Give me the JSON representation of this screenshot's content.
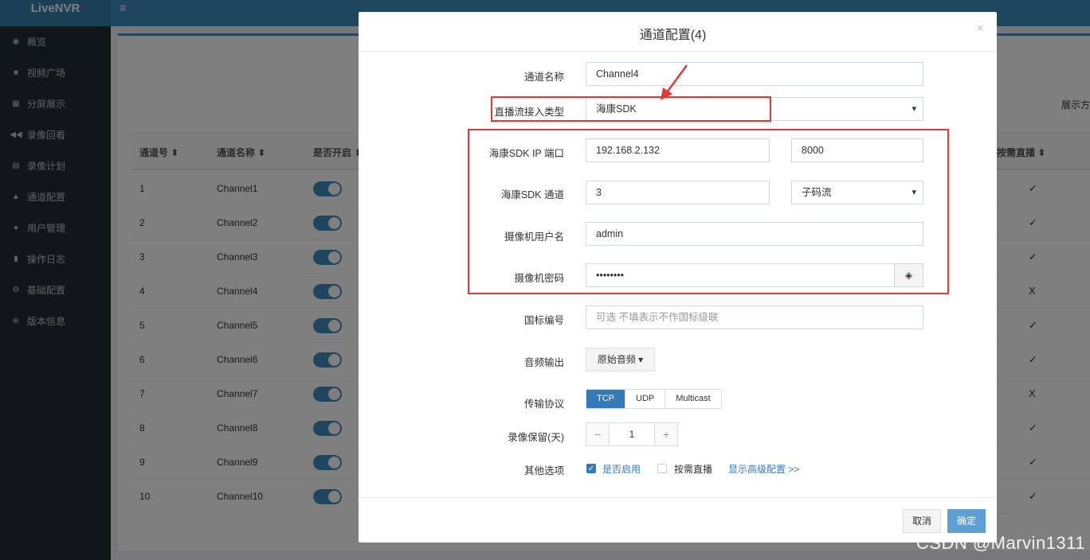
{
  "app": {
    "logo": "LiveNVR",
    "menu_glyph": "≡"
  },
  "sidebar": {
    "items": [
      {
        "label": "概览",
        "icon": "dashboard-icon"
      },
      {
        "label": "视频广场",
        "icon": "video-camera-icon"
      },
      {
        "label": "分屏展示",
        "icon": "grid-icon"
      },
      {
        "label": "录像回看",
        "icon": "rewind-icon"
      },
      {
        "label": "录像计划",
        "icon": "calendar-icon"
      },
      {
        "label": "通道配置",
        "icon": "sitemap-icon"
      },
      {
        "label": "用户管理",
        "icon": "users-icon"
      },
      {
        "label": "操作日志",
        "icon": "file-icon"
      },
      {
        "label": "基础配置",
        "icon": "gears-icon"
      },
      {
        "label": "版本信息",
        "icon": "info-icon"
      }
    ]
  },
  "background_page": {
    "display_label": "展示方",
    "columns": [
      "通道号 ⬍",
      "通道名称 ⬍",
      "是否开启 ⬍",
      "按需直播 ⬍"
    ],
    "rows": [
      {
        "id": "1",
        "name": "Channel1",
        "on_demand": "✓"
      },
      {
        "id": "2",
        "name": "Channel2",
        "on_demand": "✓"
      },
      {
        "id": "3",
        "name": "Channel3",
        "on_demand": "✓"
      },
      {
        "id": "4",
        "name": "Channel4",
        "on_demand": "X"
      },
      {
        "id": "5",
        "name": "Channel5",
        "on_demand": "✓"
      },
      {
        "id": "6",
        "name": "Channel6",
        "on_demand": "✓"
      },
      {
        "id": "7",
        "name": "Channel7",
        "on_demand": "X"
      },
      {
        "id": "8",
        "name": "Channel8",
        "on_demand": "✓"
      },
      {
        "id": "9",
        "name": "Channel9",
        "on_demand": "✓"
      },
      {
        "id": "10",
        "name": "Channel10",
        "on_demand": "✓"
      }
    ]
  },
  "modal": {
    "title": "通道配置(4)",
    "close_glyph": "×",
    "channel_name": {
      "label": "通道名称",
      "value": "Channel4"
    },
    "stream_type": {
      "label": "直播流接入类型",
      "value": "海康SDK"
    },
    "sdk_ip": {
      "label": "海康SDK IP 端口",
      "ip": "192.168.2.132",
      "port": "8000"
    },
    "sdk_channel": {
      "label": "海康SDK 通道",
      "value": "3",
      "stream": "子码流"
    },
    "camera_user": {
      "label": "摄像机用户名",
      "value": "admin"
    },
    "camera_password": {
      "label": "摄像机密码",
      "value": "••••••••"
    },
    "gb_code": {
      "label": "国标编号",
      "placeholder": "可选 不填表示不作国标级联"
    },
    "audio": {
      "label": "音频输出",
      "value": "原始音频 ▾"
    },
    "protocol": {
      "label": "传输协议",
      "options": [
        "TCP",
        "UDP",
        "Multicast"
      ],
      "selected": "TCP"
    },
    "retention": {
      "label": "录像保留(天)",
      "minus": "−",
      "value": "1",
      "plus": "+"
    },
    "other": {
      "label": "其他选项",
      "enabled": "是否启用",
      "on_demand": "按需直播",
      "advanced_link": "显示高级配置 >>"
    },
    "cancel": "取消",
    "confirm": "确定"
  },
  "watermark": "CSDN @Marvin1311",
  "colors": {
    "primary": "#3c8dbc",
    "sidebar": "#222d32",
    "annotation": "#e53935",
    "button_primary": "#5da0d6"
  }
}
